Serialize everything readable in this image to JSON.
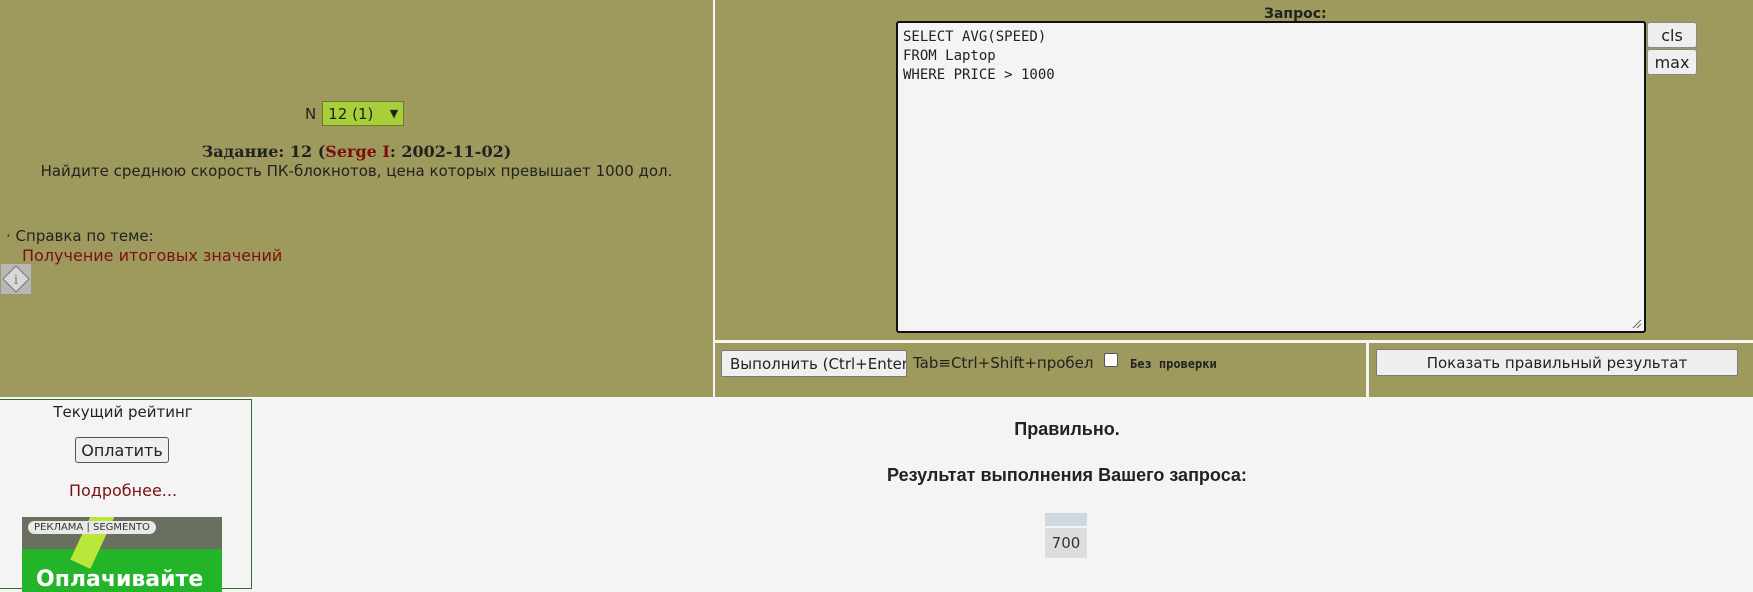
{
  "task_panel": {
    "n_label": "N",
    "n_selected": "12 (1)",
    "task_prefix": "Задание: 12 (",
    "task_author": "Serge I",
    "task_suffix": ": 2002-11-02)",
    "task_description": "Найдите среднюю скорость ПК-блокнотов, цена которых превышает 1000 дол.",
    "help_label": "· Справка по теме:",
    "help_link": "Получение итоговых значений"
  },
  "query_panel": {
    "label": "Запрос:",
    "query_text": "SELECT AVG(SPEED)\nFROM Laptop\nWHERE PRICE > 1000",
    "cls_button": "cls",
    "max_button": "max"
  },
  "action_bar": {
    "run_button": "Выполнить (Ctrl+Enter)",
    "tab_hint": "Tab≡Ctrl+Shift+пробел",
    "nocheck_label": "Без проверки",
    "nocheck_checked": false,
    "show_result_button": "Показать правильный результат"
  },
  "rating_panel": {
    "title": "Текущий рейтинг",
    "pay_button": "Оплатить",
    "more_link": "Подробнее...",
    "ad_badge": "РЕКЛАМА | SEGMENTO",
    "ad_text": "Оплачивайте"
  },
  "result": {
    "status": "Правильно.",
    "heading": "Результат выполнения Вашего запроса:",
    "columns": [
      ""
    ],
    "rows": [
      [
        "700"
      ]
    ]
  },
  "colors": {
    "olive_background": "#9e995d",
    "select_green": "#a6cf3a",
    "link_red": "#7a1010"
  }
}
